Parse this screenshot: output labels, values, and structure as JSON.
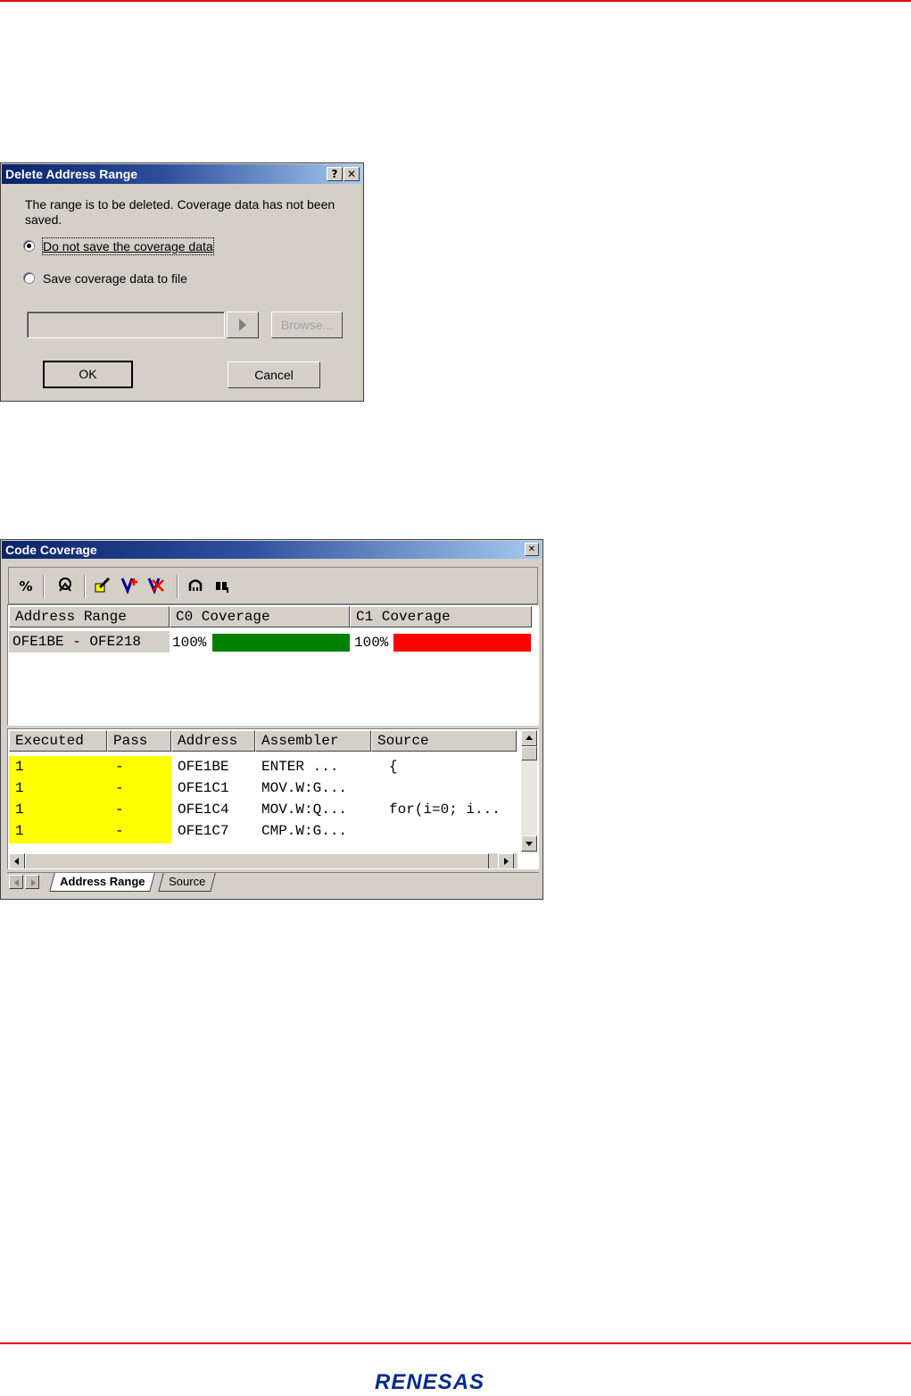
{
  "brand": {
    "logo_text": "RENESAS",
    "accent_color": "#e60012",
    "logo_color": "#0a2a8c"
  },
  "dialog": {
    "title": "Delete Address Range",
    "help_button": "?",
    "close_button": "✕",
    "message_line1": "The range is to be deleted. Coverage data has not been",
    "message_line2": "saved.",
    "option1_label": "Do not save the coverage data",
    "option1_selected": true,
    "option2_label": "Save coverage data to file",
    "file_path_value": "",
    "browse_label": "Browse...",
    "ok_label": "OK",
    "cancel_label": "Cancel"
  },
  "coverage_window": {
    "title": "Code Coverage",
    "close_button": "✕",
    "toolbar_icons": [
      "percent-icon",
      "satellite-icon",
      "edit-range-icon",
      "add-range-icon",
      "delete-range-icon",
      "refresh-icon",
      "find-icon"
    ],
    "toolbar_percent": "%",
    "range_table": {
      "headers": [
        "Address Range",
        "C0 Coverage",
        "C1 Coverage"
      ],
      "rows": [
        {
          "range": "OFE1BE - OFE218",
          "c0_text": "100%",
          "c0_percent": 100,
          "c1_text": "100%",
          "c1_percent": 100
        }
      ],
      "c0_color": "#008000",
      "c1_color": "#ff0000"
    },
    "detail_table": {
      "headers": [
        "Executed",
        "Pass",
        "Address",
        "Assembler",
        "Source"
      ],
      "rows": [
        {
          "executed": "1",
          "pass": "-",
          "address": "OFE1BE",
          "assembler": "ENTER  ...",
          "source": "{"
        },
        {
          "executed": "1",
          "pass": "-",
          "address": "OFE1C1",
          "assembler": "MOV.W:G...",
          "source": ""
        },
        {
          "executed": "1",
          "pass": "-",
          "address": "OFE1C4",
          "assembler": "MOV.W:Q...",
          "source": "for(i=0; i..."
        },
        {
          "executed": "1",
          "pass": "-",
          "address": "OFE1C7",
          "assembler": "CMP.W:G...",
          "source": ""
        }
      ],
      "highlight_color": "#ffff00"
    },
    "tabs": [
      "Address Range",
      "Source"
    ],
    "active_tab": "Address Range"
  }
}
